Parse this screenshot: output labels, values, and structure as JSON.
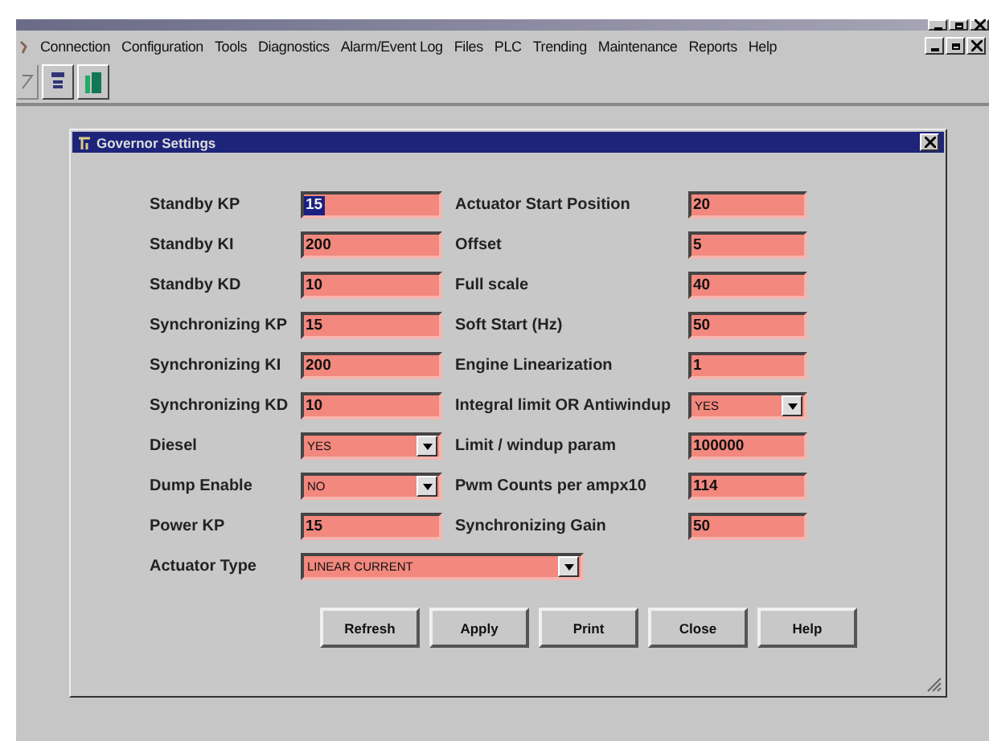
{
  "menu": [
    "Connection",
    "Configuration",
    "Tools",
    "Diagnostics",
    "Alarm/Event Log",
    "Files",
    "PLC",
    "Trending",
    "Maintenance",
    "Reports",
    "Help"
  ],
  "dialog": {
    "title": "Governor Settings"
  },
  "rows": [
    {
      "fields": [
        {
          "label": "Standby KP",
          "value": "15",
          "kind": "text",
          "selected": true
        },
        {
          "label": "Actuator Start Position",
          "value": "20",
          "kind": "text",
          "selected": false
        }
      ]
    },
    {
      "fields": [
        {
          "label": "Standby KI",
          "value": "200",
          "kind": "text",
          "selected": false
        },
        {
          "label": "Offset",
          "value": "5",
          "kind": "text",
          "selected": false
        }
      ]
    },
    {
      "fields": [
        {
          "label": "Standby KD",
          "value": "10",
          "kind": "text",
          "selected": false
        },
        {
          "label": "Full scale",
          "value": "40",
          "kind": "text",
          "selected": false
        }
      ]
    },
    {
      "fields": [
        {
          "label": "Synchronizing KP",
          "value": "15",
          "kind": "text",
          "selected": false
        },
        {
          "label": "Soft Start (Hz)",
          "value": "50",
          "kind": "text",
          "selected": false
        }
      ]
    },
    {
      "fields": [
        {
          "label": "Synchronizing KI",
          "value": "200",
          "kind": "text",
          "selected": false
        },
        {
          "label": "Engine Linearization",
          "value": "1",
          "kind": "text",
          "selected": false
        }
      ]
    },
    {
      "fields": [
        {
          "label": "Synchronizing KD",
          "value": "10",
          "kind": "text",
          "selected": false
        },
        {
          "label": "Integral limit OR Antiwindup",
          "value": "YES",
          "kind": "dropdown",
          "selected": false
        }
      ]
    },
    {
      "fields": [
        {
          "label": "Diesel",
          "value": "YES",
          "kind": "dropdown",
          "selected": false
        },
        {
          "label": "Limit / windup param",
          "value": "100000",
          "kind": "text",
          "selected": false
        }
      ]
    },
    {
      "fields": [
        {
          "label": "Dump Enable",
          "value": "NO",
          "kind": "dropdown",
          "selected": false
        },
        {
          "label": "Pwm Counts per ampx10",
          "value": "114",
          "kind": "text",
          "selected": false
        }
      ]
    },
    {
      "fields": [
        {
          "label": "Power KP",
          "value": "15",
          "kind": "text",
          "selected": false
        },
        {
          "label": "Synchronizing Gain",
          "value": "50",
          "kind": "text",
          "selected": false
        }
      ]
    },
    {
      "fields": [
        {
          "label": "Actuator Type",
          "value": "LINEAR CURRENT",
          "kind": "dropdown",
          "selected": false
        }
      ]
    }
  ],
  "buttons": [
    "Refresh",
    "Apply",
    "Print",
    "Close",
    "Help"
  ]
}
